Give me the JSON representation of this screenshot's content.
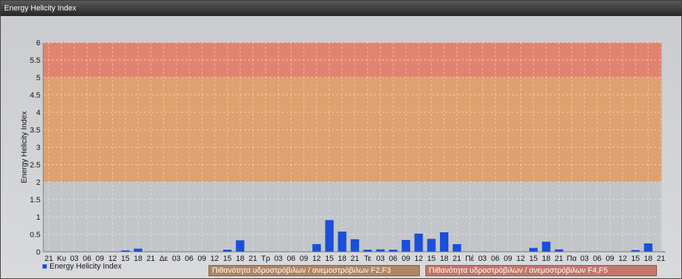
{
  "window": {
    "title": "Energy Helicity Index"
  },
  "legend": {
    "series_label": "Energy Helicity Index",
    "band_f2f3": "Πιθανότητα υδροστρόβιλων / ανεμοστρόβιλων F2,F3",
    "band_f4f5": "Πιθανότητα υδροστρόβιλων / ανεμοστρόβιλων F4,F5"
  },
  "colors": {
    "bar": "#1a4fd8",
    "band_low": "#c2c5c9",
    "band_mid": "#dea16f",
    "band_high": "#e2836f",
    "grid": "#ffffff"
  },
  "chart_data": {
    "type": "bar",
    "title": "",
    "xlabel": "",
    "ylabel": "Energy Helicity Index",
    "ylim": [
      0,
      6
    ],
    "yticks": [
      "0",
      "0.5",
      "1",
      "1.5",
      "2",
      "2.5",
      "3",
      "3.5",
      "4",
      "4.5",
      "5",
      "5.5",
      "6"
    ],
    "grid": true,
    "bands": [
      {
        "from": 0,
        "to": 2,
        "color": "#c2c5c9"
      },
      {
        "from": 2,
        "to": 5,
        "color": "#dea16f"
      },
      {
        "from": 5,
        "to": 6,
        "color": "#e2836f"
      }
    ],
    "categories": [
      "21",
      "Κυ",
      "03",
      "06",
      "09",
      "12",
      "15",
      "18",
      "21",
      "Δε",
      "03",
      "06",
      "09",
      "12",
      "15",
      "18",
      "21",
      "Τρ",
      "03",
      "06",
      "09",
      "12",
      "15",
      "18",
      "21",
      "Τε",
      "03",
      "06",
      "09",
      "12",
      "15",
      "18",
      "21",
      "Πέ",
      "03",
      "06",
      "09",
      "12",
      "15",
      "18",
      "21",
      "Πα",
      "03",
      "06",
      "09",
      "12",
      "15",
      "18",
      "21"
    ],
    "series": [
      {
        "name": "Energy Helicity Index",
        "values": [
          0.01,
          0.01,
          0.01,
          0.01,
          0.01,
          0.01,
          0.04,
          0.09,
          0.01,
          0.01,
          0.01,
          0.01,
          0.01,
          0.01,
          0.06,
          0.33,
          0.01,
          0.01,
          0.01,
          0.01,
          0.01,
          0.22,
          0.91,
          0.58,
          0.36,
          0.06,
          0.07,
          0.06,
          0.34,
          0.52,
          0.37,
          0.56,
          0.22,
          0.01,
          0.01,
          0.01,
          0.01,
          0.01,
          0.11,
          0.29,
          0.07,
          0.01,
          0.01,
          0.01,
          0.01,
          0.01,
          0.05,
          0.24,
          0.01
        ]
      }
    ]
  }
}
